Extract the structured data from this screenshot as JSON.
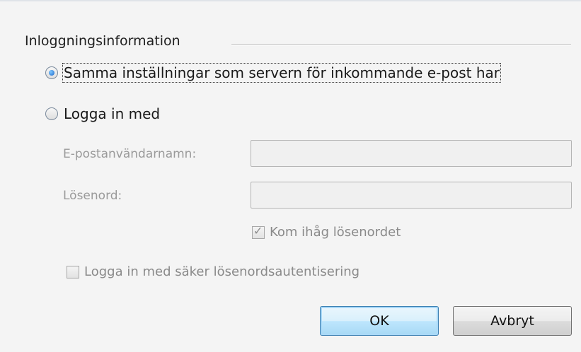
{
  "group": {
    "title": "Inloggningsinformation"
  },
  "radio_same": {
    "label": "Samma inställningar som servern för inkommande e-post har",
    "checked": true
  },
  "radio_login": {
    "label": "Logga in med",
    "checked": false
  },
  "fields": {
    "username_label": "E-postanvändarnamn:",
    "username_value": "",
    "password_label": "Lösenord:",
    "password_value": ""
  },
  "remember": {
    "label": "Kom ihåg lösenordet",
    "checked": true
  },
  "spa": {
    "label": "Logga in med säker lösenordsautentisering",
    "checked": false
  },
  "buttons": {
    "ok_label": "OK",
    "cancel_label": "Avbryt"
  },
  "colors": {
    "accent_border": "#3c7fb1",
    "disabled_text": "#9a9a9a"
  }
}
